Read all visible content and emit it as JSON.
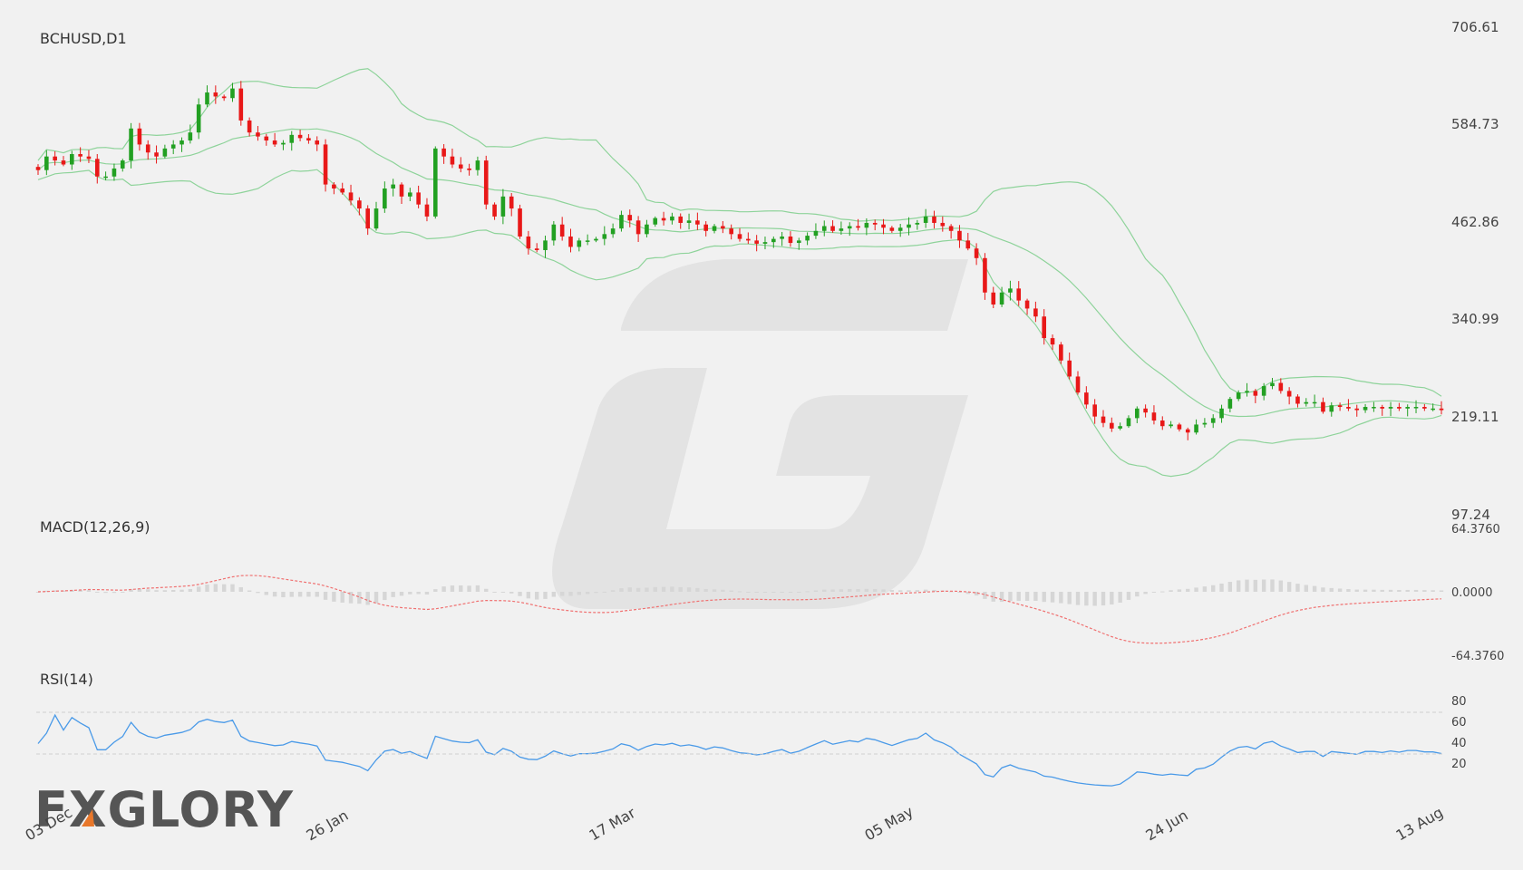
{
  "logo": {
    "text": "FXGLORY"
  },
  "chart_data": {
    "type": "candlestick",
    "title": "BCHUSD,D1",
    "price_axis": {
      "ticks": [
        "706.61",
        "584.73",
        "462.86",
        "340.99",
        "219.11",
        "97.24"
      ],
      "range": [
        97.24,
        706.61
      ]
    },
    "date_labels": [
      "03 Dec",
      "26 Jan",
      "17 Mar",
      "05 May",
      "24 Jun",
      "13 Aug"
    ],
    "price_series": [
      528,
      545,
      540,
      535,
      548,
      545,
      542,
      520,
      520,
      530,
      540,
      580,
      560,
      550,
      545,
      555,
      560,
      565,
      575,
      610,
      625,
      620,
      618,
      630,
      590,
      575,
      570,
      565,
      560,
      562,
      572,
      568,
      565,
      560,
      510,
      505,
      500,
      490,
      480,
      455,
      480,
      505,
      510,
      495,
      500,
      485,
      470,
      555,
      545,
      535,
      530,
      528,
      540,
      485,
      470,
      495,
      480,
      445,
      430,
      428,
      440,
      460,
      445,
      432,
      440,
      440,
      442,
      448,
      455,
      472,
      465,
      448,
      460,
      468,
      465,
      470,
      462,
      465,
      460,
      452,
      458,
      455,
      448,
      442,
      440,
      436,
      438,
      442,
      445,
      437,
      440,
      446,
      452,
      458,
      452,
      455,
      458,
      456,
      462,
      460,
      456,
      452,
      456,
      460,
      462,
      470,
      462,
      458,
      452,
      440,
      430,
      418,
      375,
      360,
      375,
      380,
      365,
      355,
      345,
      318,
      310,
      290,
      270,
      250,
      235,
      220,
      212,
      205,
      208,
      218,
      230,
      225,
      215,
      208,
      210,
      204,
      200,
      210,
      212,
      218,
      230,
      242,
      250,
      252,
      246,
      258,
      262,
      252,
      245,
      236,
      238,
      238,
      226,
      234,
      232,
      230,
      228,
      232,
      232,
      230,
      232,
      230,
      232,
      232,
      230,
      230,
      228
    ],
    "macd": {
      "label": "MACD(12,26,9)",
      "ticks": [
        "64.3760",
        "0.0000",
        "-64.3760"
      ],
      "range": [
        -64.376,
        64.376
      ]
    },
    "rsi": {
      "label": "RSI(14)",
      "ticks": [
        "80",
        "60",
        "40",
        "20"
      ],
      "range": [
        0,
        100
      ],
      "levels": [
        70,
        30
      ]
    },
    "indicators": [
      "Bollinger Bands",
      "MACD",
      "RSI"
    ]
  },
  "colors": {
    "up": "#22a022",
    "down": "#e81818",
    "bands": "#8ed39a",
    "signal": "#f07070",
    "histogram": "#d6d6d6",
    "rsi": "#4a9ae8",
    "watermark": "#e3e3e3"
  }
}
